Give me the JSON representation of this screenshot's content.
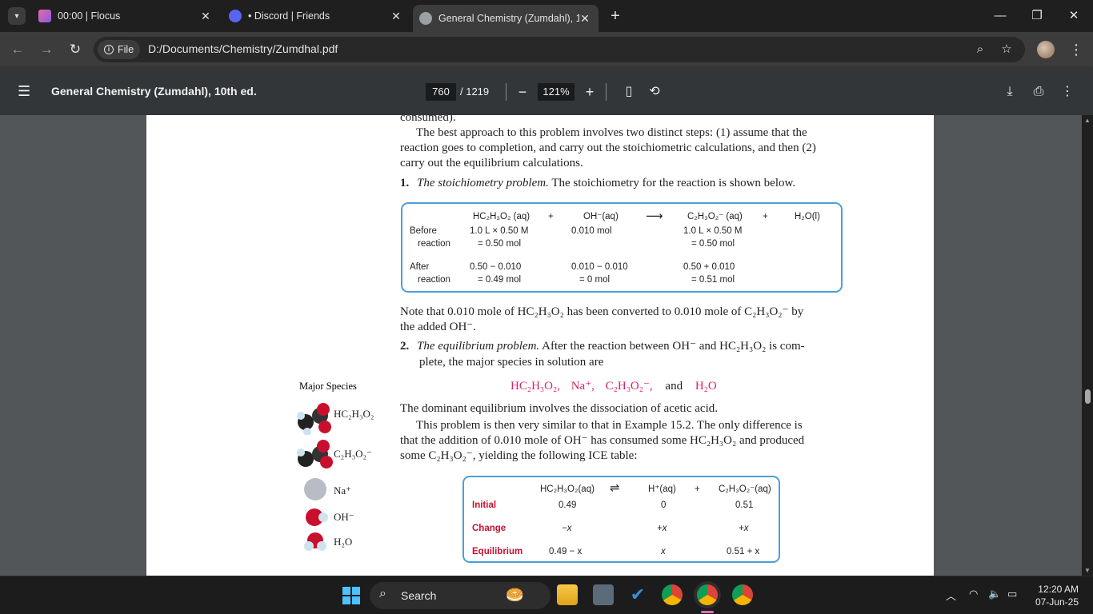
{
  "tabs": [
    {
      "title": "00:00 | Flocus",
      "active": false
    },
    {
      "title": "• Discord | Friends",
      "active": false
    },
    {
      "title": "General Chemistry (Zumdahl), 1",
      "active": true
    }
  ],
  "address": {
    "chip": "File",
    "url": "D:/Documents/Chemistry/Zumdhal.pdf"
  },
  "pdf_toolbar": {
    "title": "General Chemistry (Zumdahl), 10th ed.",
    "page": "760",
    "page_total": "/ 1219",
    "zoom": "121%"
  },
  "document": {
    "line0": "consumed).",
    "para1": [
      "The best approach to this problem involves two distinct steps: (1) assume that the",
      "reaction goes to completion, and carry out the stoichiometric calculations, and then (2)",
      "carry out the equilibrium calculations."
    ],
    "item1_num": "1.",
    "item1_italic": "The stoichiometry problem.",
    "item1_rest": "The stoichiometry for the reaction is shown below.",
    "stoich": {
      "h_reactant1": "HC₂H₃O₂ (aq)",
      "h_plus1": "+",
      "h_reactant2": "OH⁻(aq)",
      "h_arrow": "⟶",
      "h_product1": "C₂H₃O₂⁻ (aq)",
      "h_plus2": "+",
      "h_product2": "H₂O(l)",
      "before_label1": "Before",
      "before_label2": "reaction",
      "before_c1a": "1.0 L × 0.50 M",
      "before_c1b": "= 0.50 mol",
      "before_c2": "0.010 mol",
      "before_c3a": "1.0 L × 0.50 M",
      "before_c3b": "= 0.50 mol",
      "after_label1": "After",
      "after_label2": "reaction",
      "after_c1a": "0.50 − 0.010",
      "after_c1b": "= 0.49 mol",
      "after_c2a": "0.010 − 0.010",
      "after_c2b": "= 0 mol",
      "after_c3a": "0.50 + 0.010",
      "after_c3b": "= 0.51 mol"
    },
    "note1": "Note that 0.010 mole of HC₂H₃O₂ has been converted to 0.010 mole of C₂H₃O₂⁻ by",
    "note2": "the added OH⁻.",
    "item2_num": "2.",
    "item2_italic": "The equilibrium problem.",
    "item2_rest": "After the reaction between OH⁻ and HC₂H₃O₂ is com-",
    "item2_line2": "plete, the major species in solution are",
    "species_line": {
      "s1": "HC₂H₃O₂,",
      "s2": "Na⁺,",
      "s3": "C₂H₃O₂⁻,",
      "and": "and",
      "s4": "H₂O"
    },
    "para3": "The dominant equilibrium involves the dissociation of acetic acid.",
    "para4": [
      "This problem is then very similar to that in Example 15.2. The only difference is",
      "that the addition of 0.010 mole of OH⁻ has consumed some HC₂H₃O₂ and produced",
      "some C₂H₃O₂⁻, yielding the following ICE table:"
    ],
    "ice": {
      "h1": "HC₂H₃O₂(aq)",
      "harrow": "⇌",
      "h2": "H⁺(aq)",
      "hplus": "+",
      "h3": "C₂H₃O₂⁻(aq)",
      "r_initial": "Initial",
      "i1": "0.49",
      "i2": "0",
      "i3": "0.51",
      "r_change": "Change",
      "c1": "−x",
      "c2": "+x",
      "c3": "+x",
      "r_equil": "Equilibrium",
      "e1": "0.49 − x",
      "e2": "x",
      "e3": "0.51 + x"
    },
    "sidebar": {
      "header": "Major Species",
      "items": [
        "HC₂H₃O₂",
        "C₂H₃O₂⁻",
        "Na⁺",
        "OH⁻",
        "H₂O"
      ]
    }
  },
  "taskbar": {
    "search_label": "Search",
    "time": "12:20 AM",
    "date": "07-Jun-25"
  },
  "colors": {
    "accent_box": "#4d9fd9",
    "ice_label": "#c8102e",
    "species_pink": "#d6246e"
  }
}
